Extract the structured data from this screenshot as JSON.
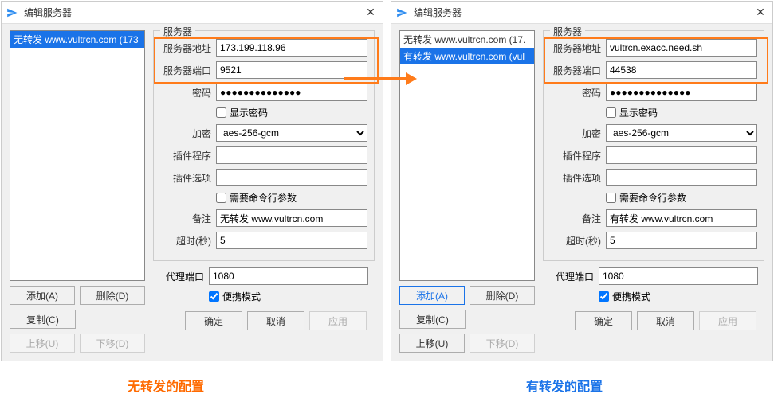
{
  "shared": {
    "window_title": "编辑服务器",
    "group_label": "服务器",
    "labels": {
      "address": "服务器地址",
      "port": "服务器端口",
      "password": "密码",
      "show_password": "显示密码",
      "encryption": "加密",
      "plugin": "插件程序",
      "plugin_opts": "插件选项",
      "need_cmd": "需要命令行参数",
      "remark": "备注",
      "timeout": "超时(秒)",
      "proxy_port": "代理端口",
      "portable": "便携模式"
    },
    "buttons": {
      "add": "添加(A)",
      "delete": "删除(D)",
      "duplicate": "复制(C)",
      "move_up": "上移(U)",
      "move_down": "下移(D)",
      "ok": "确定",
      "cancel": "取消",
      "apply": "应用"
    },
    "encryption_value": "aes-256-gcm",
    "timeout_value": "5",
    "proxy_port_value": "1080",
    "password_mask": "●●●●●●●●●●●●●●"
  },
  "left": {
    "list": {
      "items": [
        "无转发 www.vultrcn.com (173"
      ],
      "selected_index": 0
    },
    "fields": {
      "address": "173.199.118.96",
      "port": "9521",
      "plugin": "",
      "plugin_opts": "",
      "remark": "无转发 www.vultrcn.com"
    },
    "add_primary": false,
    "move_up_faded": true,
    "move_down_faded": true,
    "apply_faded": true,
    "caption": "无转发的配置"
  },
  "right": {
    "list": {
      "items": [
        "无转发 www.vultrcn.com (17.",
        "有转发 www.vultrcn.com (vul"
      ],
      "selected_index": 1
    },
    "fields": {
      "address": "vultrcn.exacc.need.sh",
      "port": "44538",
      "plugin": "",
      "plugin_opts": "",
      "remark": "有转发 www.vultrcn.com"
    },
    "add_primary": true,
    "move_up_faded": false,
    "move_down_faded": true,
    "apply_faded": true,
    "caption": "有转发的配置"
  }
}
